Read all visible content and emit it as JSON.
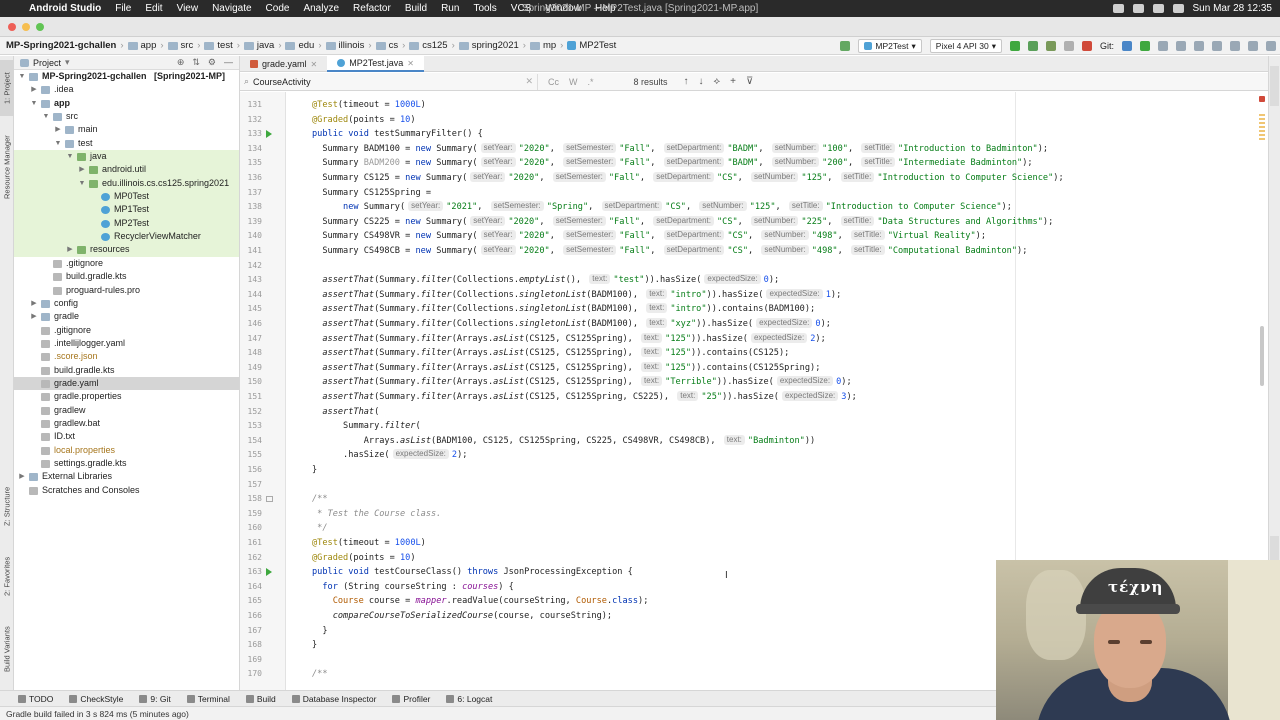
{
  "menubar": {
    "app": "Android Studio",
    "items": [
      "File",
      "Edit",
      "View",
      "Navigate",
      "Code",
      "Analyze",
      "Refactor",
      "Build",
      "Run",
      "Tools",
      "VCS",
      "Window",
      "Help"
    ],
    "window_title": "Spring2021-MP – MP2Test.java [Spring2021-MP.app]",
    "clock": "Sun Mar 28  12:35"
  },
  "navbar": {
    "crumbs": [
      "MP-Spring2021-gchallen",
      "app",
      "src",
      "test",
      "java",
      "edu",
      "illinois",
      "cs",
      "cs125",
      "spring2021",
      "mp",
      "MP2Test"
    ],
    "run_config": "MP2Test",
    "device": "Pixel 4 API 30",
    "git_label": "Git:"
  },
  "left_strip": {
    "tabs": [
      "1: Project",
      "Resource Manager",
      "Z: Structure",
      "2: Favorites",
      "Build Variants"
    ]
  },
  "project": {
    "header": "Project",
    "tree": [
      {
        "label": "MP-Spring2021-gchallen",
        "suffix": "[Spring2021-MP]",
        "level": 0,
        "open": true,
        "bold": true
      },
      {
        "label": ".idea",
        "level": 1,
        "open": false
      },
      {
        "label": "app",
        "level": 1,
        "open": true,
        "bold": true
      },
      {
        "label": "src",
        "level": 2,
        "open": true
      },
      {
        "label": "main",
        "level": 3,
        "open": false
      },
      {
        "label": "test",
        "level": 3,
        "open": true
      },
      {
        "label": "java",
        "level": 4,
        "open": true,
        "green": true
      },
      {
        "label": "android.util",
        "level": 5,
        "open": false,
        "green": true
      },
      {
        "label": "edu.illinois.cs.cs125.spring2021",
        "level": 5,
        "open": true,
        "green": true
      },
      {
        "label": "MP0Test",
        "level": 6,
        "green": true
      },
      {
        "label": "MP1Test",
        "level": 6,
        "green": true
      },
      {
        "label": "MP2Test",
        "level": 6,
        "green": true
      },
      {
        "label": "RecyclerViewMatcher",
        "level": 6,
        "green": true
      },
      {
        "label": "resources",
        "level": 4,
        "open": false,
        "green": true
      },
      {
        "label": ".gitignore",
        "level": 2
      },
      {
        "label": "build.gradle.kts",
        "level": 2
      },
      {
        "label": "proguard-rules.pro",
        "level": 2
      },
      {
        "label": "config",
        "level": 1,
        "open": false
      },
      {
        "label": "gradle",
        "level": 1,
        "open": false
      },
      {
        "label": ".gitignore",
        "level": 1
      },
      {
        "label": ".intellijlogger.yaml",
        "level": 1
      },
      {
        "label": ".score.json",
        "level": 1
      },
      {
        "label": "build.gradle.kts",
        "level": 1
      },
      {
        "label": "grade.yaml",
        "level": 1,
        "selected": true
      },
      {
        "label": "gradle.properties",
        "level": 1
      },
      {
        "label": "gradlew",
        "level": 1
      },
      {
        "label": "gradlew.bat",
        "level": 1
      },
      {
        "label": "ID.txt",
        "level": 1
      },
      {
        "label": "local.properties",
        "level": 1
      },
      {
        "label": "settings.gradle.kts",
        "level": 1
      },
      {
        "label": "External Libraries",
        "level": 0,
        "open": false
      },
      {
        "label": "Scratches and Consoles",
        "level": 0
      }
    ]
  },
  "tabs": [
    {
      "label": "grade.yaml",
      "active": false
    },
    {
      "label": "MP2Test.java",
      "active": true
    }
  ],
  "find": {
    "query": "CourseActivity",
    "results": "8 results",
    "options": [
      "Cc",
      "W",
      ".*"
    ]
  },
  "code_lines": [
    {
      "n": "131",
      "html": "<span class='ann'>@Test</span>(timeout = <span class='num'>1000L</span>)"
    },
    {
      "n": "132",
      "html": "<span class='ann'>@Graded</span>(points = <span class='num'>10</span>)"
    },
    {
      "n": "133",
      "html": "<span class='kw'>public void</span> testSummaryFilter() {",
      "run": true
    },
    {
      "n": "134",
      "html": "  Summary BADM100 = <span class='kw'>new</span> Summary(<span class='hint'>setYear:</span><span class='str'>\"2020\"</span>, <span class='hint'>setSemester:</span><span class='str'>\"Fall\"</span>, <span class='hint'>setDepartment:</span><span class='str'>\"BADM\"</span>, <span class='hint'>setNumber:</span><span class='str'>\"100\"</span>, <span class='hint'>setTitle:</span><span class='str'>\"Introduction to Badminton\"</span>);"
    },
    {
      "n": "135",
      "html": "  Summary <span style='color:#999'>BADM200</span> = <span class='kw'>new</span> Summary(<span class='hint'>setYear:</span><span class='str'>\"2020\"</span>, <span class='hint'>setSemester:</span><span class='str'>\"Fall\"</span>, <span class='hint'>setDepartment:</span><span class='str'>\"BADM\"</span>, <span class='hint'>setNumber:</span><span class='str'>\"200\"</span>, <span class='hint'>setTitle:</span><span class='str'>\"Intermediate Badminton\"</span>);"
    },
    {
      "n": "136",
      "html": "  Summary CS125 = <span class='kw'>new</span> Summary(<span class='hint'>setYear:</span><span class='str'>\"2020\"</span>, <span class='hint'>setSemester:</span><span class='str'>\"Fall\"</span>, <span class='hint'>setDepartment:</span><span class='str'>\"CS\"</span>, <span class='hint'>setNumber:</span><span class='str'>\"125\"</span>, <span class='hint'>setTitle:</span><span class='str'>\"Introduction to Computer Science\"</span>);"
    },
    {
      "n": "137",
      "html": "  Summary CS125Spring ="
    },
    {
      "n": "138",
      "html": "      <span class='kw'>new</span> Summary(<span class='hint'>setYear:</span><span class='str'>\"2021\"</span>, <span class='hint'>setSemester:</span><span class='str'>\"Spring\"</span>, <span class='hint'>setDepartment:</span><span class='str'>\"CS\"</span>, <span class='hint'>setNumber:</span><span class='str'>\"125\"</span>, <span class='hint'>setTitle:</span><span class='str'>\"Introduction to Computer Science\"</span>);"
    },
    {
      "n": "139",
      "html": "  Summary CS225 = <span class='kw'>new</span> Summary(<span class='hint'>setYear:</span><span class='str'>\"2020\"</span>, <span class='hint'>setSemester:</span><span class='str'>\"Fall\"</span>, <span class='hint'>setDepartment:</span><span class='str'>\"CS\"</span>, <span class='hint'>setNumber:</span><span class='str'>\"225\"</span>, <span class='hint'>setTitle:</span><span class='str'>\"Data Structures and Algorithms\"</span>);"
    },
    {
      "n": "140",
      "html": "  Summary CS498VR = <span class='kw'>new</span> Summary(<span class='hint'>setYear:</span><span class='str'>\"2020\"</span>, <span class='hint'>setSemester:</span><span class='str'>\"Fall\"</span>, <span class='hint'>setDepartment:</span><span class='str'>\"CS\"</span>, <span class='hint'>setNumber:</span><span class='str'>\"498\"</span>, <span class='hint'>setTitle:</span><span class='str'>\"Virtual Reality\"</span>);"
    },
    {
      "n": "141",
      "html": "  Summary CS498CB = <span class='kw'>new</span> Summary(<span class='hint'>setYear:</span><span class='str'>\"2020\"</span>, <span class='hint'>setSemester:</span><span class='str'>\"Fall\"</span>, <span class='hint'>setDepartment:</span><span class='str'>\"CS\"</span>, <span class='hint'>setNumber:</span><span class='str'>\"498\"</span>, <span class='hint'>setTitle:</span><span class='str'>\"Computational Badminton\"</span>);"
    },
    {
      "n": "142",
      "html": ""
    },
    {
      "n": "143",
      "html": "  <span class='it'>assertThat</span>(Summary.<span class='it'>filter</span>(Collections.<span class='it'>emptyList</span>(), <span class='hint'>text:</span><span class='str'>\"test\"</span>)).hasSize(<span class='hint'>expectedSize:</span><span class='num'>0</span>);"
    },
    {
      "n": "144",
      "html": "  <span class='it'>assertThat</span>(Summary.<span class='it'>filter</span>(Collections.<span class='it'>singletonList</span>(BADM100), <span class='hint'>text:</span><span class='str'>\"intro\"</span>)).hasSize(<span class='hint'>expectedSize:</span><span class='num'>1</span>);"
    },
    {
      "n": "145",
      "html": "  <span class='it'>assertThat</span>(Summary.<span class='it'>filter</span>(Collections.<span class='it'>singletonList</span>(BADM100), <span class='hint'>text:</span><span class='str'>\"intro\"</span>)).contains(BADM100);"
    },
    {
      "n": "146",
      "html": "  <span class='it'>assertThat</span>(Summary.<span class='it'>filter</span>(Collections.<span class='it'>singletonList</span>(BADM100), <span class='hint'>text:</span><span class='str'>\"xyz\"</span>)).hasSize(<span class='hint'>expectedSize:</span><span class='num'>0</span>);"
    },
    {
      "n": "147",
      "html": "  <span class='it'>assertThat</span>(Summary.<span class='it'>filter</span>(Arrays.<span class='it'>asList</span>(CS125, CS125Spring), <span class='hint'>text:</span><span class='str'>\"125\"</span>)).hasSize(<span class='hint'>expectedSize:</span><span class='num'>2</span>);"
    },
    {
      "n": "148",
      "html": "  <span class='it'>assertThat</span>(Summary.<span class='it'>filter</span>(Arrays.<span class='it'>asList</span>(CS125, CS125Spring), <span class='hint'>text:</span><span class='str'>\"125\"</span>)).contains(CS125);"
    },
    {
      "n": "149",
      "html": "  <span class='it'>assertThat</span>(Summary.<span class='it'>filter</span>(Arrays.<span class='it'>asList</span>(CS125, CS125Spring), <span class='hint'>text:</span><span class='str'>\"125\"</span>)).contains(CS125Spring);"
    },
    {
      "n": "150",
      "html": "  <span class='it'>assertThat</span>(Summary.<span class='it'>filter</span>(Arrays.<span class='it'>asList</span>(CS125, CS125Spring), <span class='hint'>text:</span><span class='str'>\"Terrible\"</span>)).hasSize(<span class='hint'>expectedSize:</span><span class='num'>0</span>);"
    },
    {
      "n": "151",
      "html": "  <span class='it'>assertThat</span>(Summary.<span class='it'>filter</span>(Arrays.<span class='it'>asList</span>(CS125, CS125Spring, CS225), <span class='hint'>text:</span><span class='str'>\"25\"</span>)).hasSize(<span class='hint'>expectedSize:</span><span class='num'>3</span>);"
    },
    {
      "n": "152",
      "html": "  <span class='it'>assertThat</span>("
    },
    {
      "n": "153",
      "html": "      Summary.<span class='it'>filter</span>("
    },
    {
      "n": "154",
      "html": "          Arrays.<span class='it'>asList</span>(BADM100, CS125, CS125Spring, CS225, CS498VR, CS498CB), <span class='hint'>text:</span><span class='str'>\"Badminton\"</span>))"
    },
    {
      "n": "155",
      "html": "      .hasSize(<span class='hint'>expectedSize:</span><span class='num'>2</span>);"
    },
    {
      "n": "156",
      "html": "}"
    },
    {
      "n": "157",
      "html": ""
    },
    {
      "n": "158",
      "html": "<span class='cmt'>/**</span>",
      "fold": true
    },
    {
      "n": "159",
      "html": "<span class='cmt'> * Test the Course class.</span>"
    },
    {
      "n": "160",
      "html": "<span class='cmt'> */</span>"
    },
    {
      "n": "161",
      "html": "<span class='ann'>@Test</span>(timeout = <span class='num'>1000L</span>)"
    },
    {
      "n": "162",
      "html": "<span class='ann'>@Graded</span>(points = <span class='num'>10</span>)"
    },
    {
      "n": "163",
      "html": "<span class='kw'>public void</span> testCourseClass() <span class='kw'>throws</span> JsonProcessingException {",
      "run": true
    },
    {
      "n": "164",
      "html": "  <span class='kw'>for</span> (String courseString : <span class='fld it'>courses</span>) {"
    },
    {
      "n": "165",
      "html": "    <span style='color:#b05a00'>Course</span> course = <span class='fld it'>mapper</span>.readValue(courseString, <span style='color:#b05a00'>Course</span>.<span class='kw'>class</span>);"
    },
    {
      "n": "166",
      "html": "    <span class='it'>compareCourseToSerializedCourse</span>(course, courseString);"
    },
    {
      "n": "167",
      "html": "  }"
    },
    {
      "n": "168",
      "html": "}"
    },
    {
      "n": "169",
      "html": ""
    },
    {
      "n": "170",
      "html": "<span class='cmt'>/**</span>"
    }
  ],
  "bottom_tools": [
    "TODO",
    "CheckStyle",
    "9: Git",
    "Terminal",
    "Build",
    "Database Inspector",
    "Profiler",
    "6: Logcat"
  ],
  "status": "Gradle build failed in 3 s 824 ms (5 minutes ago)",
  "webcam_cap_text": "τέχνη"
}
